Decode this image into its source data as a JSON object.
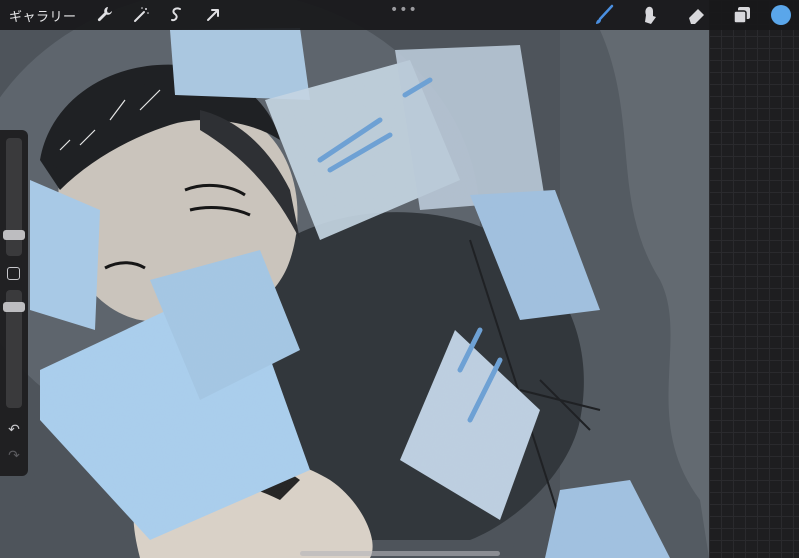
{
  "app": {
    "gallery_label": "ギャラリー",
    "more_label": "•••"
  },
  "toolbar_left": [
    {
      "name": "wrench-icon"
    },
    {
      "name": "magic-wand-icon"
    },
    {
      "name": "selection-icon"
    },
    {
      "name": "transform-icon"
    }
  ],
  "toolbar_right": [
    {
      "name": "brush-icon"
    },
    {
      "name": "smudge-icon"
    },
    {
      "name": "eraser-icon"
    },
    {
      "name": "layers-icon"
    }
  ],
  "colors": {
    "current_color": "#5aa6ea",
    "brush_accent": "#4a8fe0"
  },
  "sidebar": {
    "undo_label": "↶",
    "redo_label": "↷"
  }
}
